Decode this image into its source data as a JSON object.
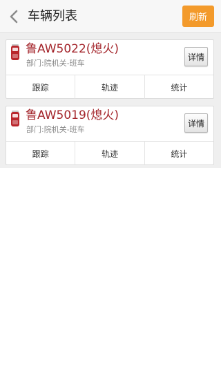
{
  "colors": {
    "accent": "#f39a2b",
    "plate_text": "#a4262c",
    "status_icon": "#b9262c"
  },
  "header": {
    "back_icon": "chevron-left-icon",
    "title": "车辆列表",
    "refresh_label": "刷新"
  },
  "vehicles": [
    {
      "icon": "vehicle-status-icon",
      "plate": "鲁AW5022(熄火)",
      "department": "部门:院机关-班车",
      "detail_label": "详情",
      "actions": [
        "跟踪",
        "轨迹",
        "统计"
      ]
    },
    {
      "icon": "vehicle-status-icon",
      "plate": "鲁AW5019(熄火)",
      "department": "部门:院机关-班车",
      "detail_label": "详情",
      "actions": [
        "跟踪",
        "轨迹",
        "统计"
      ]
    }
  ]
}
